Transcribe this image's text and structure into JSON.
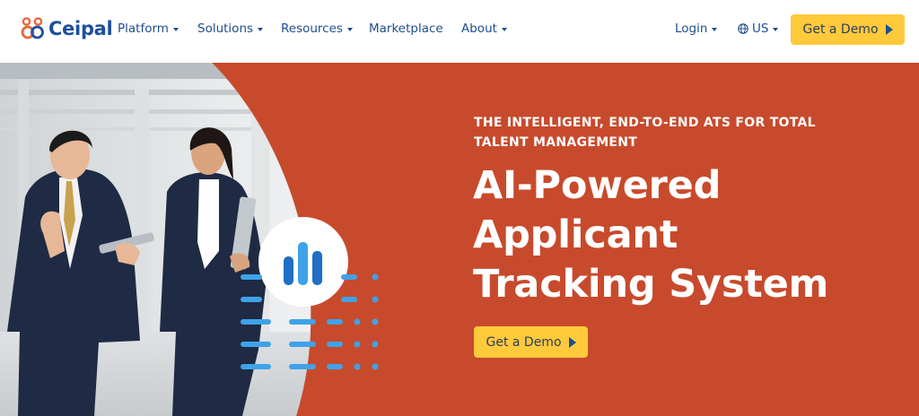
{
  "brand": {
    "name": "Ceipal"
  },
  "nav": {
    "items": [
      {
        "label": "Platform",
        "has_dropdown": true
      },
      {
        "label": "Solutions",
        "has_dropdown": true
      },
      {
        "label": "Resources",
        "has_dropdown": true
      },
      {
        "label": "Marketplace",
        "has_dropdown": false
      },
      {
        "label": "About",
        "has_dropdown": true
      }
    ],
    "login": "Login",
    "region": "US",
    "cta": "Get a Demo"
  },
  "hero": {
    "eyebrow": "THE INTELLIGENT, END-TO-END ATS FOR TOTAL TALENT MANAGEMENT",
    "headline_lines": [
      "AI-Powered",
      "Applicant",
      "Tracking System"
    ],
    "cta": "Get a Demo"
  },
  "colors": {
    "brand_blue": "#1e4f9c",
    "brand_orange": "#e8663a",
    "hero_bg": "#c84a2c",
    "cta_yellow": "#ffc93c",
    "accent_blue": "#3fa2e8"
  },
  "icons": [
    "logo-mark-icon",
    "chevron-down-icon",
    "globe-icon",
    "play-icon",
    "bar-chart-icon"
  ]
}
